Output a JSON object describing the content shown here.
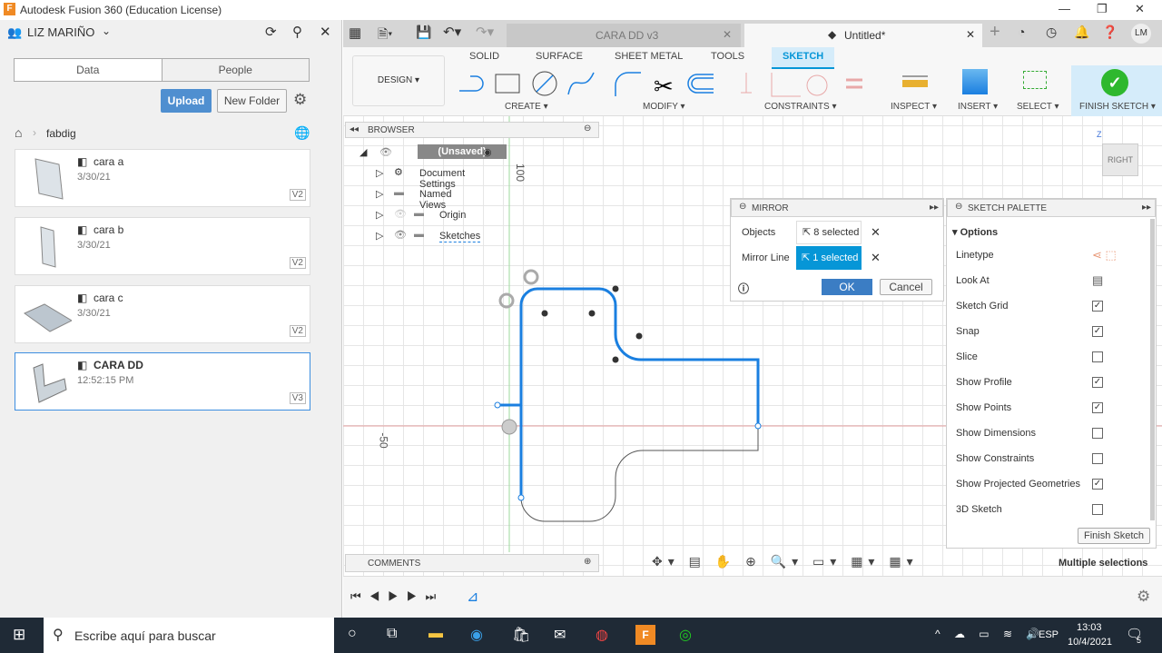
{
  "window": {
    "title": "Autodesk Fusion 360 (Education License)",
    "app_icon": "F"
  },
  "left_panel": {
    "user": "LIZ MARIÑO",
    "tabs": [
      "Data",
      "People"
    ],
    "upload": "Upload",
    "new_folder": "New Folder",
    "breadcrumb": "fabdig",
    "files": [
      {
        "name": "cara a",
        "date": "3/30/21",
        "version": "V2"
      },
      {
        "name": "cara b",
        "date": "3/30/21",
        "version": "V2"
      },
      {
        "name": "cara c",
        "date": "3/30/21",
        "version": "V2"
      },
      {
        "name": "CARA DD",
        "date": "12:52:15 PM",
        "version": "V3",
        "selected": true
      }
    ]
  },
  "doc_tabs": [
    {
      "label": "CARA DD v3"
    },
    {
      "label": "Untitled*",
      "active": true
    }
  ],
  "user_initials": "LM",
  "toolbar": {
    "workspace": "DESIGN",
    "tabs": [
      "SOLID",
      "SURFACE",
      "SHEET METAL",
      "TOOLS",
      "SKETCH"
    ],
    "active_tab": "SKETCH",
    "groups": [
      "CREATE",
      "MODIFY",
      "CONSTRAINTS",
      "INSPECT",
      "INSERT",
      "SELECT",
      "FINISH SKETCH"
    ]
  },
  "browser": {
    "title": "BROWSER",
    "root": "(Unsaved)",
    "items": [
      "Document Settings",
      "Named Views",
      "Origin",
      "Sketches"
    ]
  },
  "comments": "COMMENTS",
  "axis_labels": {
    "v": "100",
    "h": "-50"
  },
  "mirror": {
    "title": "MIRROR",
    "objects_label": "Objects",
    "objects_value": "8 selected",
    "line_label": "Mirror Line",
    "line_value": "1 selected",
    "ok": "OK",
    "cancel": "Cancel"
  },
  "palette": {
    "title": "SKETCH PALETTE",
    "section": "Options",
    "rows": [
      {
        "label": "Linetype"
      },
      {
        "label": "Look At"
      },
      {
        "label": "Sketch Grid",
        "checked": true
      },
      {
        "label": "Snap",
        "checked": true
      },
      {
        "label": "Slice",
        "checked": false
      },
      {
        "label": "Show Profile",
        "checked": true
      },
      {
        "label": "Show Points",
        "checked": true
      },
      {
        "label": "Show Dimensions",
        "checked": false
      },
      {
        "label": "Show Constraints",
        "checked": false
      },
      {
        "label": "Show Projected Geometries",
        "checked": true
      },
      {
        "label": "3D Sketch",
        "checked": false
      }
    ],
    "finish": "Finish Sketch"
  },
  "status": "Multiple selections",
  "viewcube": {
    "face": "RIGHT",
    "axis": "Z"
  },
  "taskbar": {
    "search": "Escribe aquí para buscar",
    "lang": "ESP",
    "time": "13:03",
    "date": "10/4/2021",
    "notif": "5"
  },
  "colors": {
    "accent": "#0696d7",
    "sketch": "#1a7fe0",
    "finish": "#2eb82e"
  }
}
